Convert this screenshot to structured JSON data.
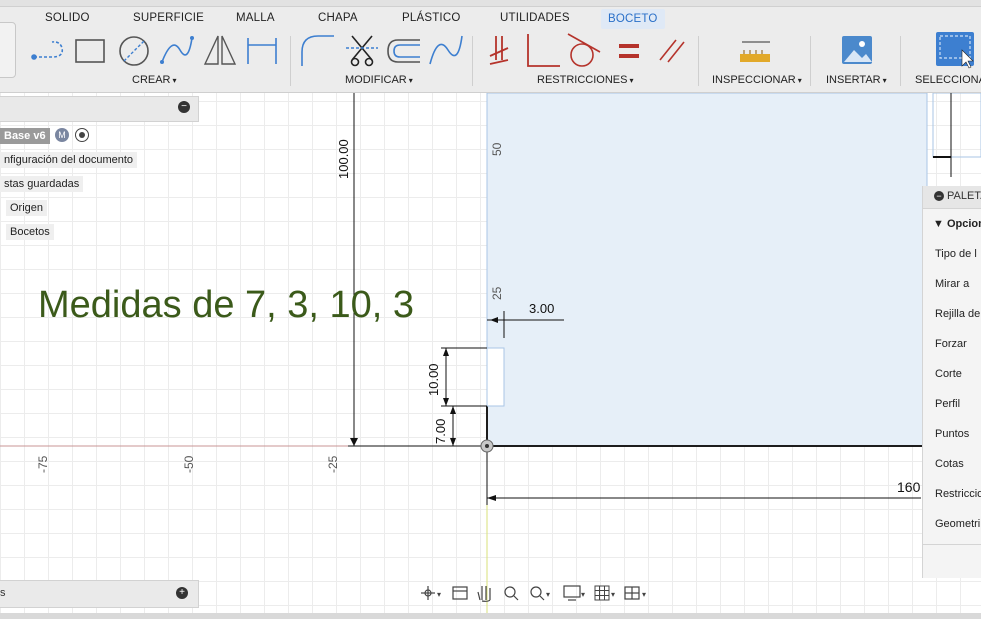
{
  "tabs": [
    "SOLIDO",
    "SUPERFICIE",
    "MALLA",
    "CHAPA",
    "PLÁSTICO",
    "UTILIDADES",
    "BOCETO"
  ],
  "active_tab": "BOCETO",
  "groups": {
    "crear": "CREAR",
    "modificar": "MODIFICAR",
    "restricciones": "RESTRICCIONES",
    "inspeccionar": "INSPECCIONAR",
    "insertar": "INSERTAR",
    "seleccionar": "SELECCIONA"
  },
  "browser": {
    "root": "Base v6",
    "items": [
      "nfiguración del documento",
      "stas guardadas",
      "Origen",
      "Bocetos"
    ]
  },
  "annotation": "Medidas de 7, 3, 10, 3",
  "sketch": {
    "dim_vertical_total": "100.00",
    "dim_offset": "3.00",
    "dim_rect_height": "10.00",
    "dim_rect_offset": "7.00",
    "dim_horizontal": "160",
    "ruler_x": [
      "-75",
      "-50",
      "-25"
    ],
    "ruler_y": [
      "50",
      "25"
    ]
  },
  "palette": {
    "header": "PALETA",
    "section": "Opcion",
    "items": [
      "Tipo de l",
      "Mirar a",
      "Rejilla de",
      "Forzar",
      "Corte",
      "Perfil",
      "Puntos",
      "Cotas",
      "Restriccio",
      "Geometri"
    ]
  },
  "bottom_left_label": "s",
  "colors": {
    "active_tab": "#2a70c8",
    "annotation": "#3b5a1a",
    "constraint_red": "#b5332b",
    "sketch_fill": "#e6eff8",
    "select_blue": "#3d7fd0"
  }
}
